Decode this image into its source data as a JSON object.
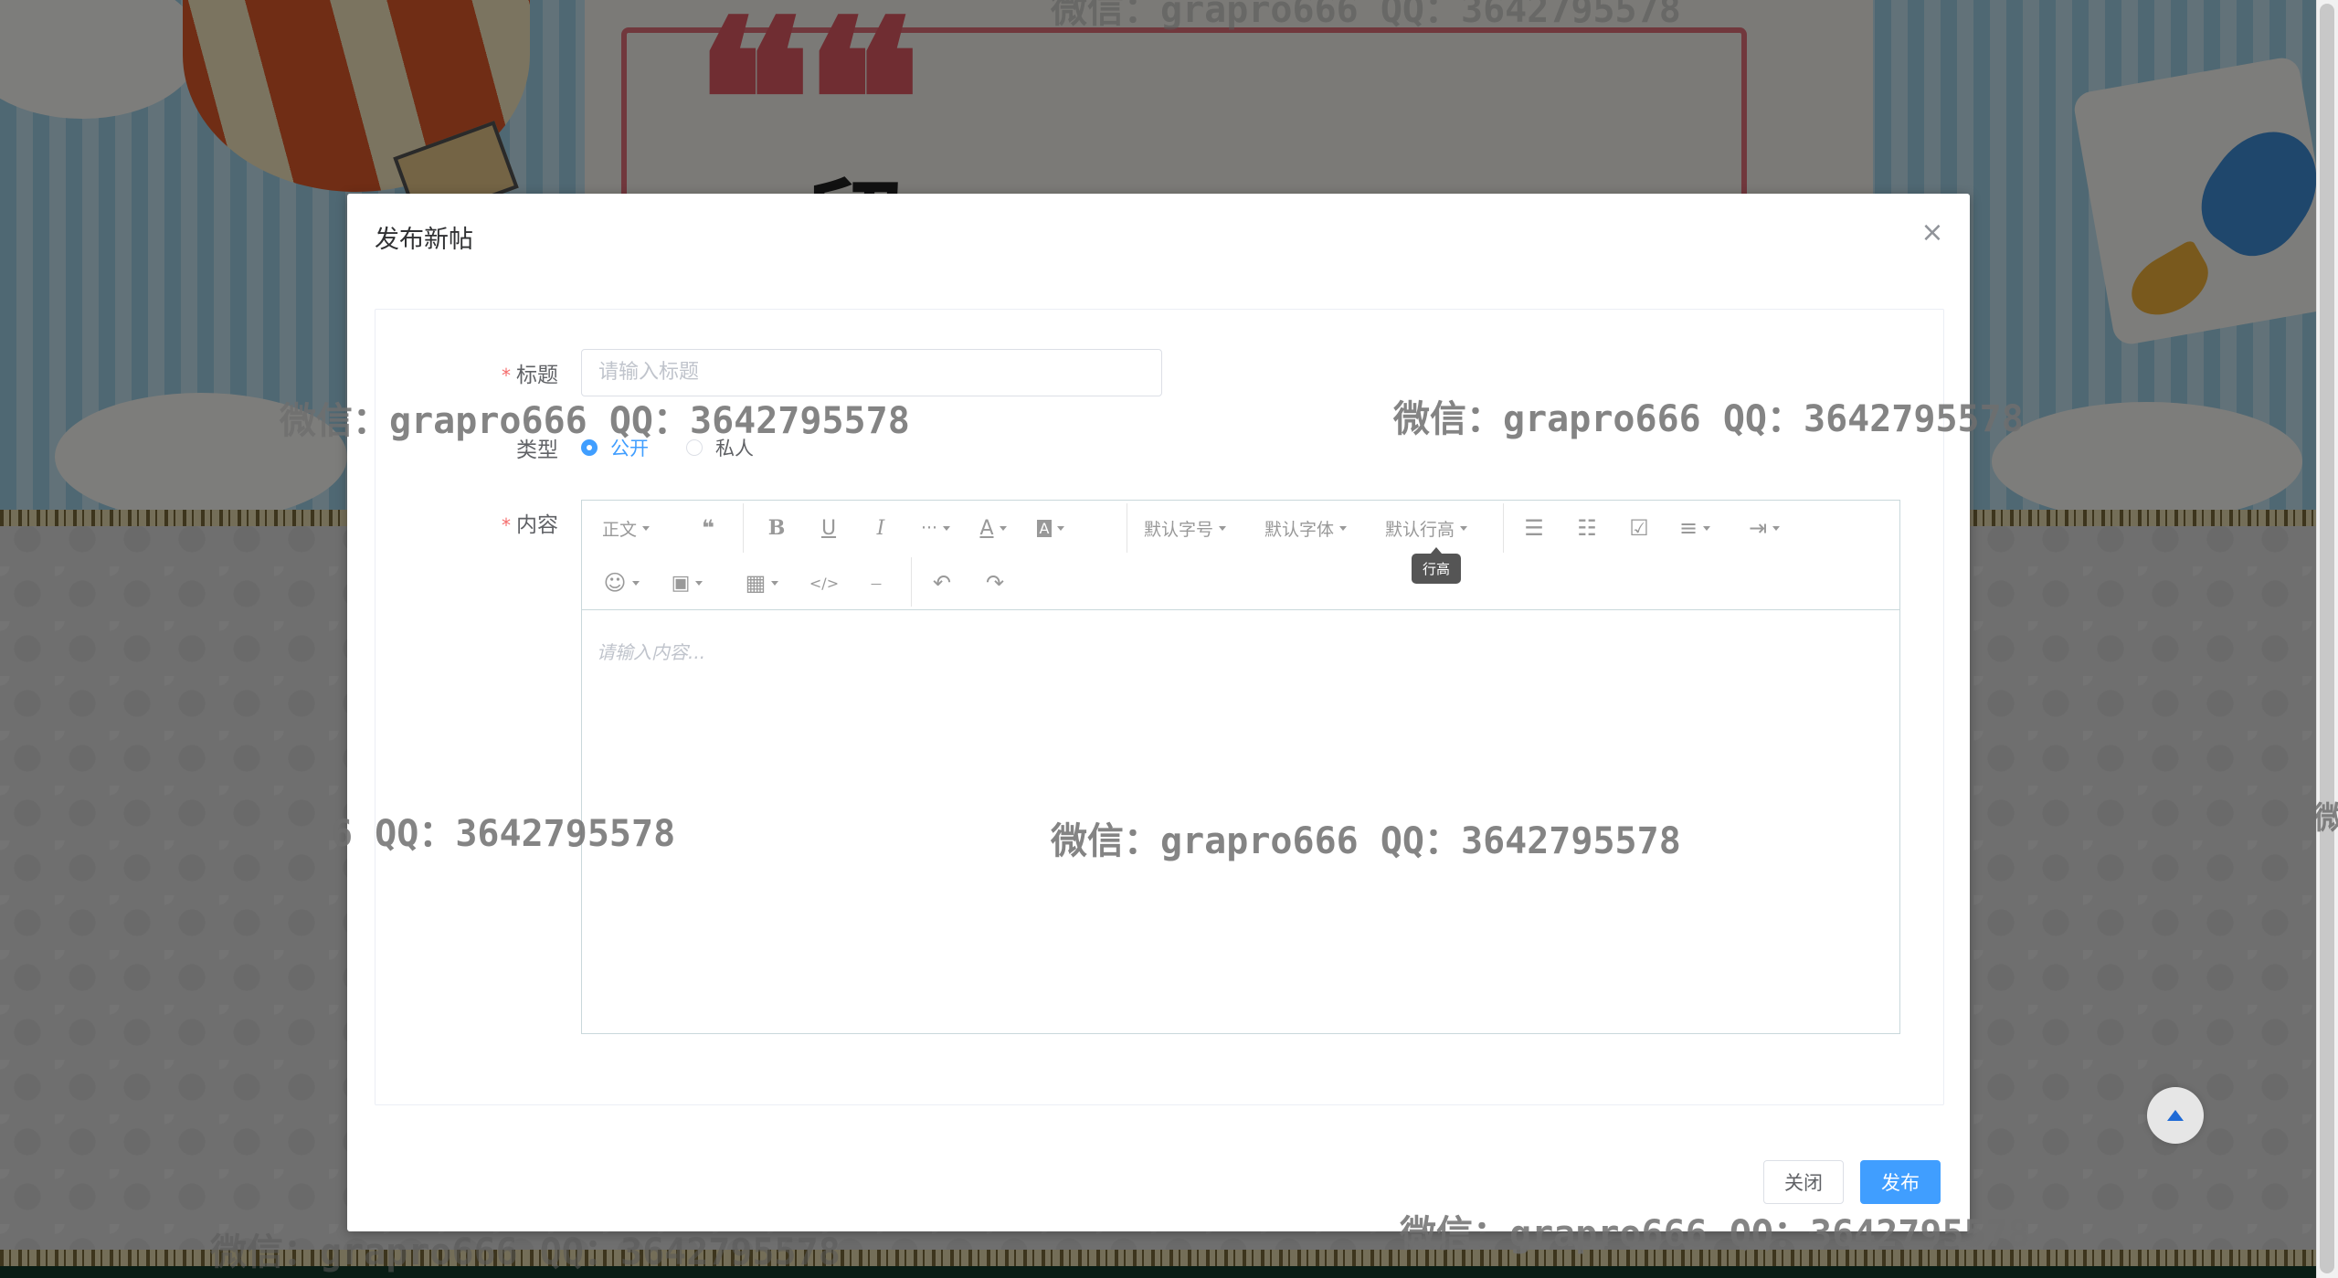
{
  "dialog": {
    "title": "发布新帖",
    "close_icon": "×"
  },
  "form": {
    "title_label": "标题",
    "title_placeholder": "请输入标题",
    "type_label": "类型",
    "type_options": [
      {
        "label": "公开",
        "checked": true
      },
      {
        "label": "私人",
        "checked": false
      }
    ],
    "content_label": "内容",
    "required_mark": "*"
  },
  "editor": {
    "toolbar_row1": [
      {
        "name": "paragraph-format",
        "label": "正文",
        "dropdown": true
      },
      {
        "name": "blockquote-icon",
        "label": "❝",
        "dropdown": false
      },
      {
        "name": "bold-icon",
        "label": "B",
        "dropdown": false
      },
      {
        "name": "underline-icon",
        "label": "U",
        "dropdown": false
      },
      {
        "name": "italic-icon",
        "label": "I",
        "dropdown": false
      },
      {
        "name": "more-icon",
        "label": "···",
        "dropdown": true
      },
      {
        "name": "font-color-icon",
        "label": "A",
        "dropdown": true
      },
      {
        "name": "bg-color-icon",
        "label": "A",
        "dropdown": true
      },
      {
        "name": "font-size-select",
        "label": "默认字号",
        "dropdown": true
      },
      {
        "name": "font-family-select",
        "label": "默认字体",
        "dropdown": true
      },
      {
        "name": "line-height-select",
        "label": "默认行高",
        "dropdown": true
      },
      {
        "name": "bulleted-list-icon",
        "label": "☰",
        "dropdown": false
      },
      {
        "name": "numbered-list-icon",
        "label": "☷",
        "dropdown": false
      },
      {
        "name": "todo-icon",
        "label": "☑",
        "dropdown": false
      },
      {
        "name": "justify-icon",
        "label": "≡",
        "dropdown": true
      },
      {
        "name": "indent-icon",
        "label": "⇥",
        "dropdown": true
      }
    ],
    "toolbar_row2": [
      {
        "name": "emoji-icon",
        "label": "☺",
        "dropdown": true
      },
      {
        "name": "image-icon",
        "label": "▣",
        "dropdown": true
      },
      {
        "name": "table-icon",
        "label": "▦",
        "dropdown": true
      },
      {
        "name": "code-icon",
        "label": "</>",
        "dropdown": false
      },
      {
        "name": "divider-icon",
        "label": "⎯",
        "dropdown": false
      },
      {
        "name": "undo-icon",
        "label": "↶",
        "dropdown": false
      },
      {
        "name": "redo-icon",
        "label": "↷",
        "dropdown": false
      }
    ],
    "tooltip": "行高",
    "placeholder": "请输入内容..."
  },
  "footer": {
    "close_label": "关闭",
    "publish_label": "发布"
  },
  "watermark": "微信：grapro666 QQ：3642795578",
  "watermark_partial": "6 QQ：3642795578",
  "watermark_edge": "微",
  "background": {
    "board_title": "留"
  },
  "colors": {
    "primary": "#409eff",
    "required": "#f56c6c",
    "mask": "rgba(0,0,0,0.5)"
  }
}
